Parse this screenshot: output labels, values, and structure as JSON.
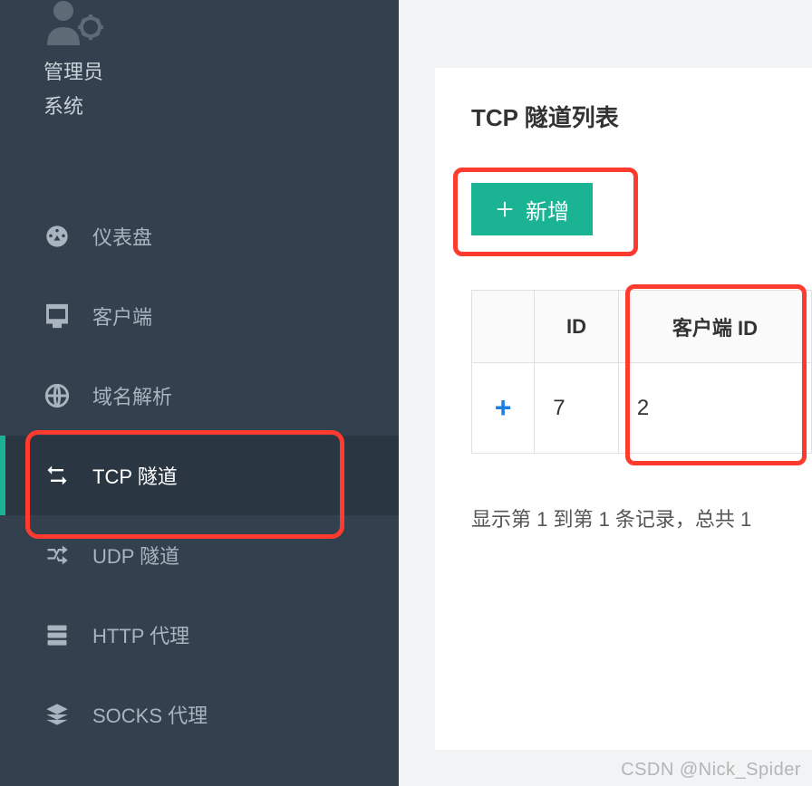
{
  "user": {
    "role": "管理员",
    "system": "系统"
  },
  "sidebar": {
    "items": [
      {
        "label": "仪表盘",
        "icon": "dashboard-icon"
      },
      {
        "label": "客户端",
        "icon": "monitor-icon"
      },
      {
        "label": "域名解析",
        "icon": "globe-icon"
      },
      {
        "label": "TCP 隧道",
        "icon": "swap-icon"
      },
      {
        "label": "UDP 隧道",
        "icon": "shuffle-icon"
      },
      {
        "label": "HTTP 代理",
        "icon": "server-icon"
      },
      {
        "label": "SOCKS 代理",
        "icon": "layers-icon"
      }
    ]
  },
  "card": {
    "title": "TCP 隧道列表",
    "add_label": "新增"
  },
  "table": {
    "headers": {
      "expand": "",
      "id": "ID",
      "client_id": "客户端 ID"
    },
    "rows": [
      {
        "id": "7",
        "client_id": "2"
      }
    ]
  },
  "pagination": {
    "text": "显示第 1 到第 1 条记录，总共 1"
  },
  "watermark": "CSDN @Nick_Spider",
  "colors": {
    "accent": "#1ab394",
    "sidebar_bg": "#33404d",
    "highlight": "#ff3b30"
  }
}
